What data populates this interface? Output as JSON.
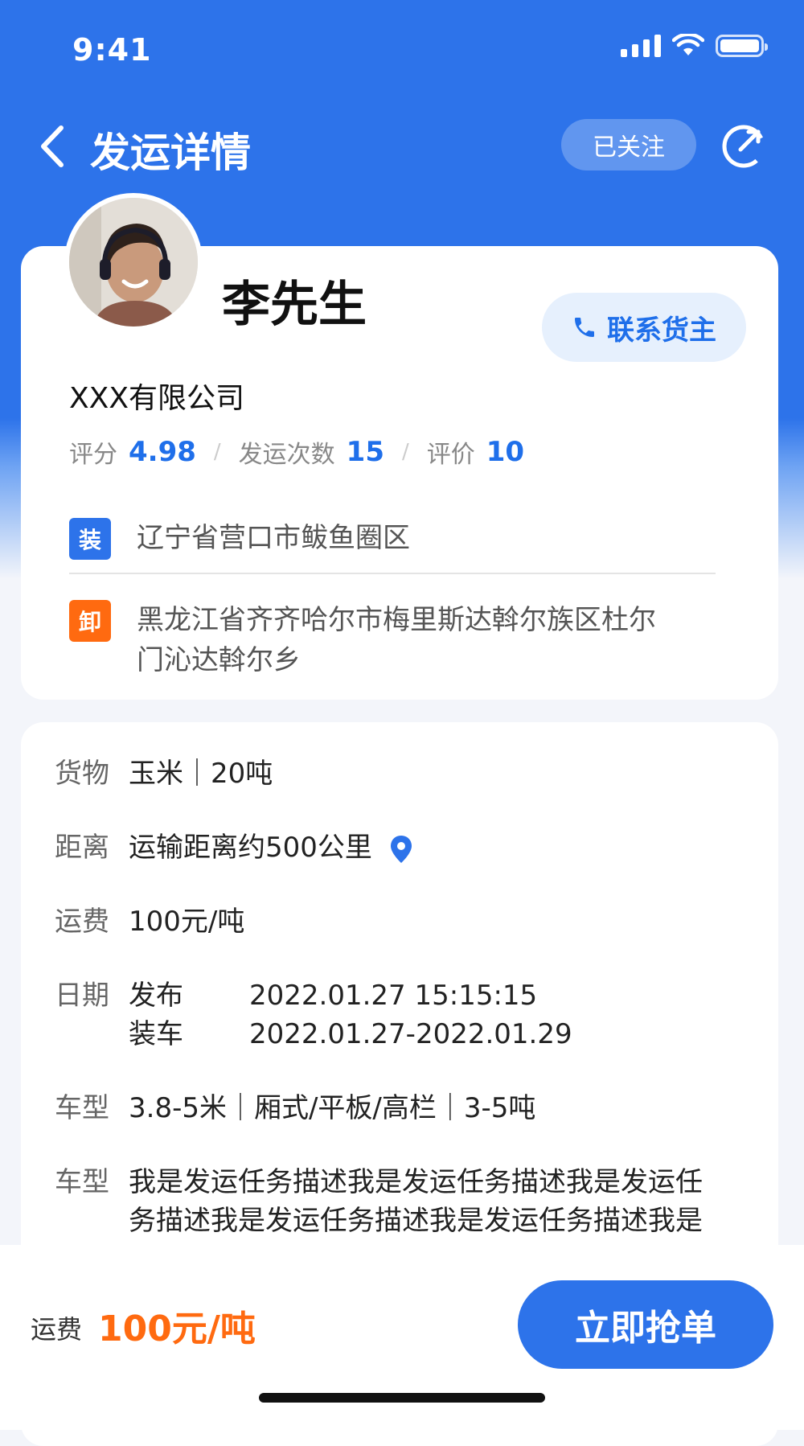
{
  "status_bar": {
    "time": "9:41",
    "signal_icon": "cellular-signal-icon",
    "wifi_icon": "wifi-icon",
    "battery_icon": "battery-icon"
  },
  "nav": {
    "title": "发运详情",
    "follow_label": "已关注",
    "back_icon": "chevron-left-icon",
    "share_icon": "share-icon"
  },
  "owner": {
    "name": "李先生",
    "company": "XXX有限公司",
    "contact_label": "联系货主",
    "contact_icon": "phone-icon",
    "stats": [
      {
        "label": "评分",
        "value": "4.98"
      },
      {
        "label": "发运次数",
        "value": "15"
      },
      {
        "label": "评价",
        "value": "10"
      }
    ]
  },
  "route": {
    "load": {
      "tag": "装",
      "address": "辽宁省营口市鲅鱼圈区"
    },
    "unload": {
      "tag": "卸",
      "address_line1": "黑龙江省齐齐哈尔市梅里斯达斡尔族区杜尔",
      "address_line2": "门沁达斡尔乡"
    }
  },
  "details": {
    "cargo": {
      "label": "货物",
      "value": "玉米｜20吨"
    },
    "distance": {
      "label": "距离",
      "value": "运输距离约500公里",
      "icon": "location-pin-icon"
    },
    "freight": {
      "label": "运费",
      "value": "100元/吨"
    },
    "date": {
      "label": "日期",
      "publish_label": "发布",
      "publish_value": "2022.01.27 15:15:15",
      "load_label": "装车",
      "load_value": "2022.01.27-2022.01.29"
    },
    "vehicle": {
      "label": "车型",
      "value": "3.8-5米｜厢式/平板/高栏｜3-5吨"
    },
    "description": {
      "label": "车型",
      "line1": "我是发运任务描述我是发运任务描述我是发运任",
      "line2": "务描述我是发运任务描述我是发运任务描述我是"
    }
  },
  "bottom": {
    "fee_label": "运费",
    "fee_value": "100元/吨",
    "grab_label": "立即抢单"
  },
  "colors": {
    "primary": "#2d73ea",
    "accent_orange": "#ff6a10",
    "background": "#f3f5fa"
  }
}
